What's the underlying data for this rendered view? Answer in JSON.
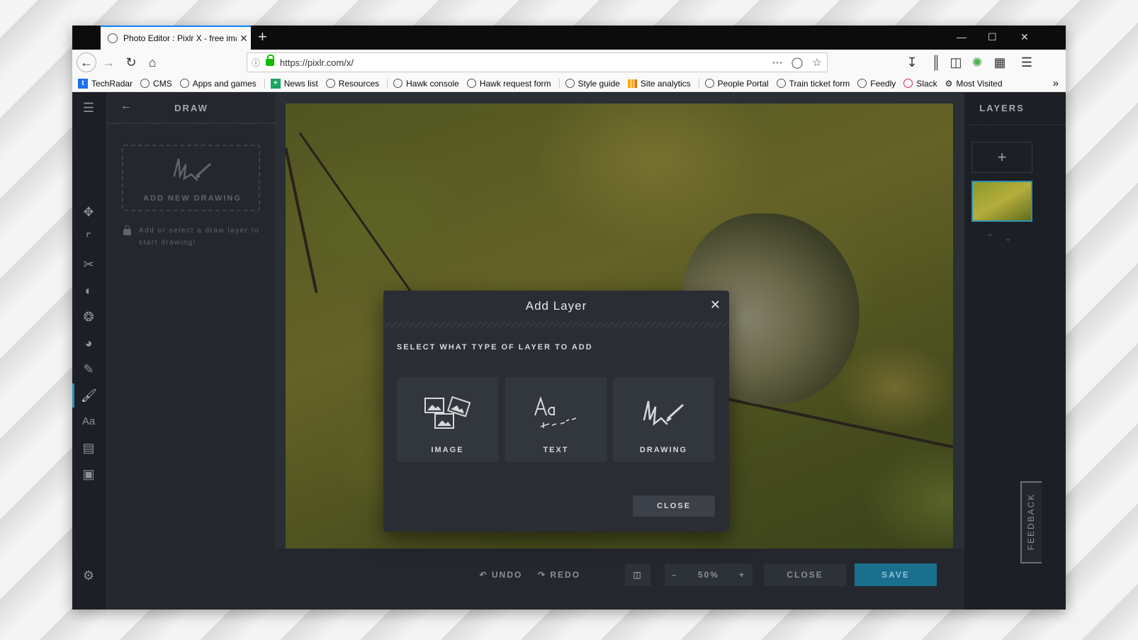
{
  "browser": {
    "tab_title": "Photo Editor : Pixlr X - free ima",
    "tab_close": "✕",
    "new_tab": "+",
    "minimize": "—",
    "maximize": "☐",
    "close": "✕",
    "url": "https://pixlr.com/x/",
    "bookmarks": [
      "TechRadar",
      "CMS",
      "Apps and games",
      "News list",
      "Resources",
      "Hawk console",
      "Hawk request form",
      "Style guide",
      "Site analytics",
      "People Portal",
      "Train ticket form",
      "Feedly",
      "Slack",
      "Most Visited"
    ]
  },
  "draw_panel": {
    "title": "DRAW",
    "add_new": "ADD NEW DRAWING",
    "hint": "Add or select a draw layer to start drawing!"
  },
  "layers_panel": {
    "title": "LAYERS",
    "add": "+",
    "feedback": "FEEDBACK"
  },
  "bottom": {
    "undo": "UNDO",
    "redo": "REDO",
    "zoom_minus": "–",
    "zoom": "50%",
    "zoom_plus": "+",
    "close": "CLOSE",
    "save": "SAVE"
  },
  "modal": {
    "title": "Add Layer",
    "close_icon": "✕",
    "prompt": "SELECT WHAT TYPE OF LAYER TO ADD",
    "options": [
      "IMAGE",
      "TEXT",
      "DRAWING"
    ],
    "close_button": "CLOSE"
  }
}
